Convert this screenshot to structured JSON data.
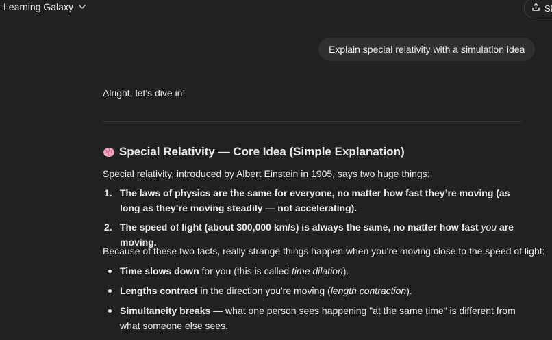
{
  "header": {
    "model_name": "Learning Galaxy",
    "share_label": "Share"
  },
  "user_message": "Explain special relativity with a simulation idea",
  "reply": {
    "intro": "Alright, let’s dive in!",
    "heading": "Special Relativity — Core Idea (Simple Explanation)",
    "heading_icon": "brain-icon",
    "lead": "Special relativity, introduced by Albert Einstein in 1905, says two huge things:",
    "ordered": [
      {
        "num": "1.",
        "text": "The laws of physics are the same for everyone, no matter how fast they’re moving (as long as they’re moving steadily — not accelerating)."
      },
      {
        "num": "2.",
        "text_before": "The speed of light (about 300,000 km/s) is always the same, no matter how fast ",
        "text_em": "you",
        "text_after": " are moving."
      }
    ],
    "because": "Because of these two facts, really strange things happen when you're moving close to the speed of light:",
    "bullets": [
      {
        "bold": "Time slows down",
        "text": " for you (this is called ",
        "em": "time dilation",
        "after": ")."
      },
      {
        "bold": "Lengths contract",
        "text": " in the direction you're moving (",
        "em": "length contraction",
        "after": ")."
      },
      {
        "bold": "Simultaneity breaks",
        "text": " — what one person sees happening \"at the same time\" is different from what someone else sees.",
        "em": "",
        "after": ""
      }
    ]
  },
  "colors": {
    "background": "#212121",
    "bubble": "#303030",
    "text": "#ececec",
    "divider": "#333333"
  }
}
